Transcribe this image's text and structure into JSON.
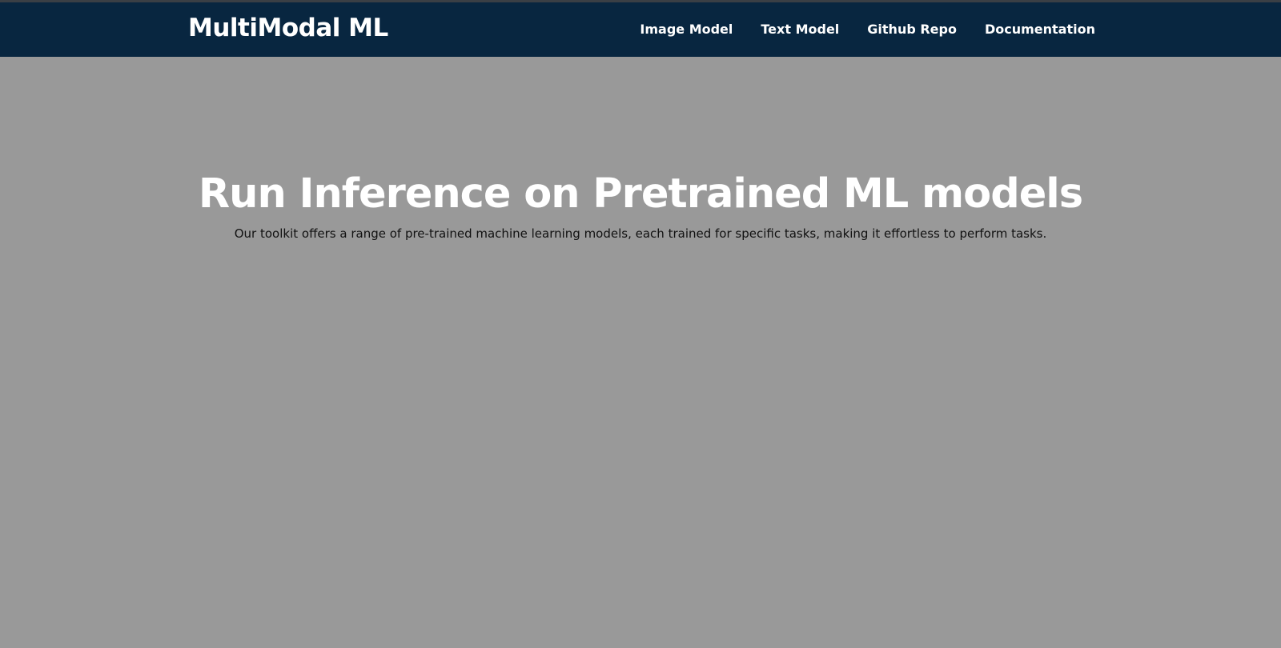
{
  "colors": {
    "navbar_bg": "#082640",
    "page_bg": "#999999",
    "title_text": "#ffffff",
    "subtitle_text": "#111111"
  },
  "navbar": {
    "brand": "MultiModal ML",
    "links": [
      {
        "label": "Image Model"
      },
      {
        "label": "Text Model"
      },
      {
        "label": "Github Repo"
      },
      {
        "label": "Documentation"
      }
    ]
  },
  "hero": {
    "title": "Run Inference on Pretrained ML models",
    "subtitle": "Our toolkit offers a range of pre-trained machine learning models, each trained for specific tasks, making it effortless to perform tasks."
  }
}
